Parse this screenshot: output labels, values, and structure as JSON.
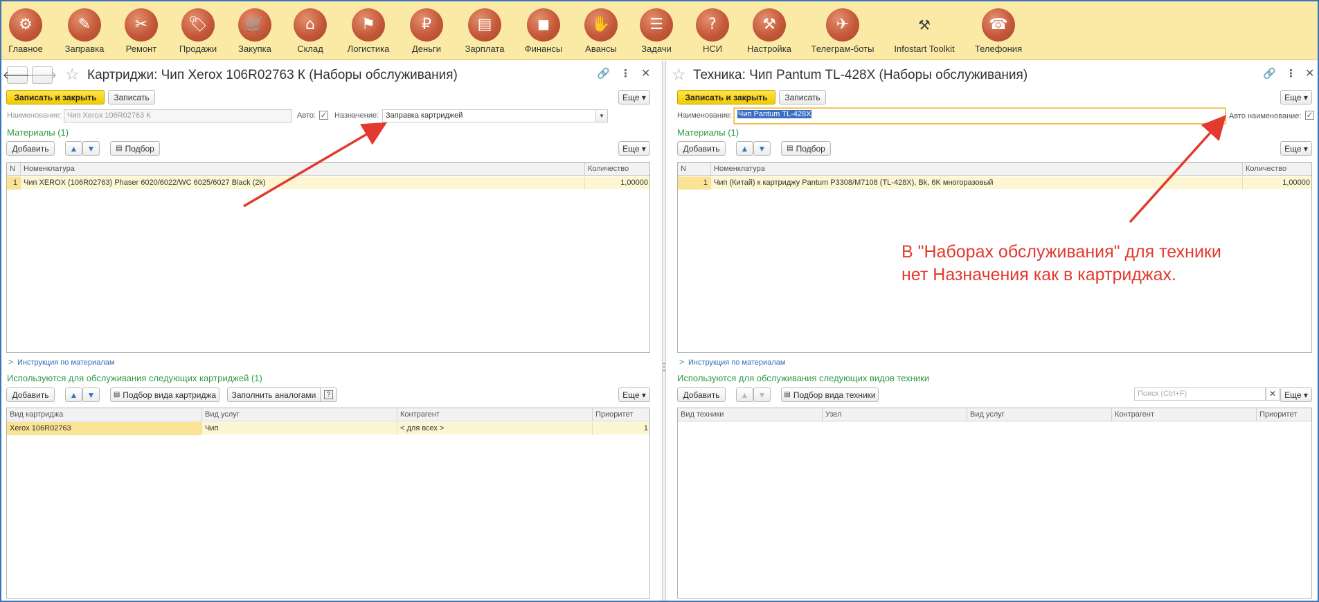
{
  "sections": [
    {
      "label": "Главное",
      "icon": "⚙",
      "name": "gear"
    },
    {
      "label": "Заправка",
      "icon": "✎",
      "name": "refill"
    },
    {
      "label": "Ремонт",
      "icon": "✂",
      "name": "repair-tools"
    },
    {
      "label": "Продажи",
      "icon": "🏷",
      "name": "sale-tag"
    },
    {
      "label": "Закупка",
      "icon": "🛒",
      "name": "cart"
    },
    {
      "label": "Склад",
      "icon": "⌂",
      "name": "warehouse"
    },
    {
      "label": "Логистика",
      "icon": "⚑",
      "name": "map-pin"
    },
    {
      "label": "Деньги",
      "icon": "₽",
      "name": "money-bag"
    },
    {
      "label": "Зарплата",
      "icon": "▤",
      "name": "wallet"
    },
    {
      "label": "Финансы",
      "icon": "◼",
      "name": "briefcase"
    },
    {
      "label": "Авансы",
      "icon": "✋",
      "name": "hand-money"
    },
    {
      "label": "Задачи",
      "icon": "☰",
      "name": "checklist"
    },
    {
      "label": "НСИ",
      "icon": "?",
      "name": "reference-book"
    },
    {
      "label": "Настройка",
      "icon": "⚒",
      "name": "settings-tools"
    },
    {
      "label": "Телеграм-боты",
      "icon": "✈",
      "name": "telegram"
    },
    {
      "label": "Infostart Toolkit",
      "icon": "⚒",
      "name": "toolkit"
    },
    {
      "label": "Телефония",
      "icon": "☎",
      "name": "telephone"
    }
  ],
  "left": {
    "title": "Картриджи: Чип Xerox 106R02763 К (Наборы обслуживания)",
    "save_close": "Записать и закрыть",
    "save": "Записать",
    "more": "Еще",
    "name_label": "Наименование:",
    "name_value": "Чип Xerox 106R02763 К",
    "auto_label": "Авто:",
    "auto_checked": true,
    "purpose_label": "Назначение:",
    "purpose_value": "Заправка картриджей",
    "materials_title": "Материалы (1)",
    "add": "Добавить",
    "pick": "Подбор",
    "materials_columns": [
      "N",
      "Номенклатура",
      "Количество"
    ],
    "materials_rows": [
      {
        "n": "1",
        "item": "Чип  XEROX (106R02763)    Phaser 6020/6022/WC 6025/6027 Black  (2k)",
        "qty": "1,00000"
      }
    ],
    "instruction_link": "Инструкция по материалам",
    "usage_title": "Используются для обслуживания следующих картриджей (1)",
    "pick_kind": "Подбор вида картриджа",
    "fill_analogs": "Заполнить аналогами",
    "usage_columns": [
      "Вид картриджа",
      "Вид услуг",
      "Контрагент",
      "Приоритет"
    ],
    "usage_rows": [
      {
        "kind": "Xerox 106R02763",
        "service": "Чип",
        "contractor": "< для всех >",
        "priority": "1"
      }
    ]
  },
  "right": {
    "title": "Техника: Чип Pantum TL-428X (Наборы обслуживания)",
    "save_close": "Записать и закрыть",
    "save": "Записать",
    "more": "Еще",
    "name_label": "Наименование:",
    "name_value": "Чип Pantum TL-428X",
    "auto_label": "Авто наименование:",
    "auto_checked": true,
    "materials_title": "Материалы (1)",
    "add": "Добавить",
    "pick": "Подбор",
    "materials_columns": [
      "N",
      "Номенклатура",
      "Количество"
    ],
    "materials_rows": [
      {
        "n": "1",
        "item": "Чип (Китай) к картриджу Pantum P3308/M7108 (TL-428X), Bk, 6K многоразовый",
        "qty": "1,00000"
      }
    ],
    "instruction_link": "Инструкция по материалам",
    "usage_title": "Используются для обслуживания следующих видов техники",
    "pick_kind": "Подбор вида техники",
    "search_placeholder": "Поиск (Ctrl+F)",
    "usage_columns": [
      "Вид техники",
      "Узел",
      "Вид услуг",
      "Контрагент",
      "Приоритет"
    ]
  },
  "annotation": {
    "line1": "В \"Наборах обслуживания\" для техники",
    "line2": "нет Назначения как в картриджах."
  }
}
